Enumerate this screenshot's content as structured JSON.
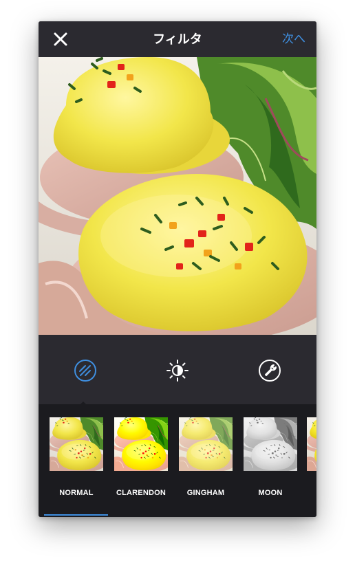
{
  "header": {
    "title": "フィルタ",
    "next_label": "次へ"
  },
  "icons": {
    "close": "close-icon",
    "lux": "lux-wand-icon",
    "brightness": "brightness-icon",
    "edit": "edit-wrench-icon"
  },
  "tools": {
    "active": "lux"
  },
  "filters": [
    {
      "label": "NORMAL",
      "selected": true
    },
    {
      "label": "CLARENDON",
      "selected": false
    },
    {
      "label": "GINGHAM",
      "selected": false
    },
    {
      "label": "MOON",
      "selected": false
    }
  ],
  "colors": {
    "background": "#2b2a30",
    "filter_strip": "#1b1b1f",
    "accent": "#3f8fe0",
    "text": "#ffffff"
  }
}
